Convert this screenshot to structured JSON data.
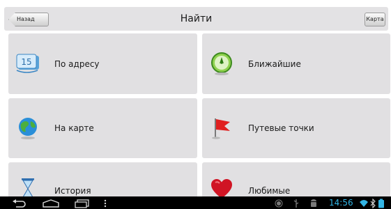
{
  "header": {
    "title": "Найти",
    "back_label": "Назад",
    "map_label": "Карта"
  },
  "tiles": [
    {
      "label": "По адресу",
      "icon": "address-book-icon"
    },
    {
      "label": "Ближайшие",
      "icon": "compass-icon"
    },
    {
      "label": "На карте",
      "icon": "globe-icon"
    },
    {
      "label": "Путевые точки",
      "icon": "red-flag-icon"
    },
    {
      "label": "История",
      "icon": "hourglass-icon"
    },
    {
      "label": "Любимые",
      "icon": "heart-icon"
    }
  ],
  "address_icon_number": "15",
  "statusbar": {
    "time": "14:56"
  },
  "colors": {
    "accent_clock": "#33b5e5",
    "tile_bg": "#e1e0e2",
    "header_bg": "#e3e2e4"
  }
}
